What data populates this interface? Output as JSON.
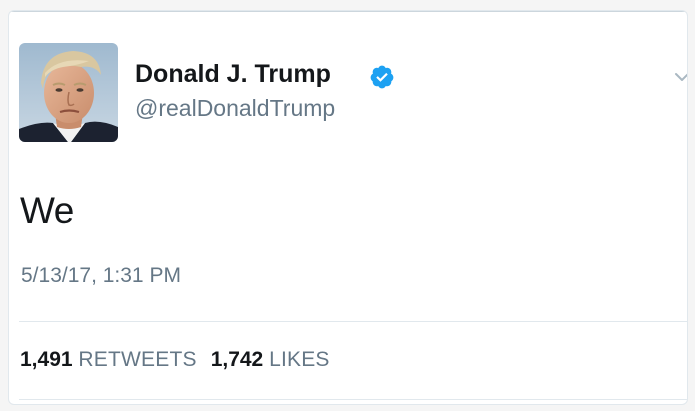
{
  "tweet": {
    "author_name": "Donald J. Trump",
    "author_handle": "@realDonaldTrump",
    "verified_icon": "verified-badge-icon",
    "menu_icon": "chevron-down-icon",
    "text": "We",
    "timestamp": "5/13/17, 1:31 PM",
    "stats": {
      "retweets_count": "1,491",
      "retweets_label": "RETWEETS",
      "likes_count": "1,742",
      "likes_label": "LIKES"
    }
  },
  "colors": {
    "verified_blue": "#1da1f2",
    "secondary_text": "#657786",
    "primary_text": "#14171a",
    "border": "#e1e8ed"
  }
}
